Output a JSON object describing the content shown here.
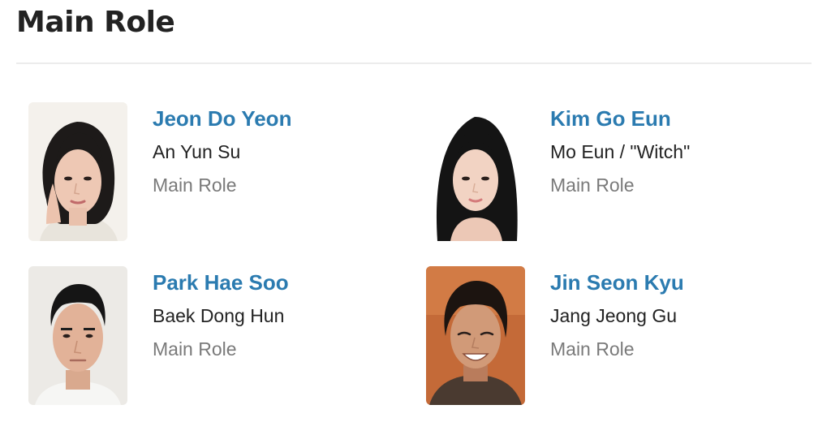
{
  "section": {
    "title": "Main Role"
  },
  "cast": [
    {
      "actor": "Jeon Do Yeon",
      "character": "An Yun Su",
      "role": "Main Role"
    },
    {
      "actor": "Kim Go Eun",
      "character": "Mo Eun / \"Witch\"",
      "role": "Main Role"
    },
    {
      "actor": "Park Hae Soo",
      "character": "Baek Dong Hun",
      "role": "Main Role"
    },
    {
      "actor": "Jin Seon Kyu",
      "character": "Jang Jeong Gu",
      "role": "Main Role"
    }
  ],
  "colors": {
    "actor_link": "#2b7bb0",
    "character_text": "#222222",
    "role_text": "#7a7a7a",
    "divider": "#ececec"
  }
}
